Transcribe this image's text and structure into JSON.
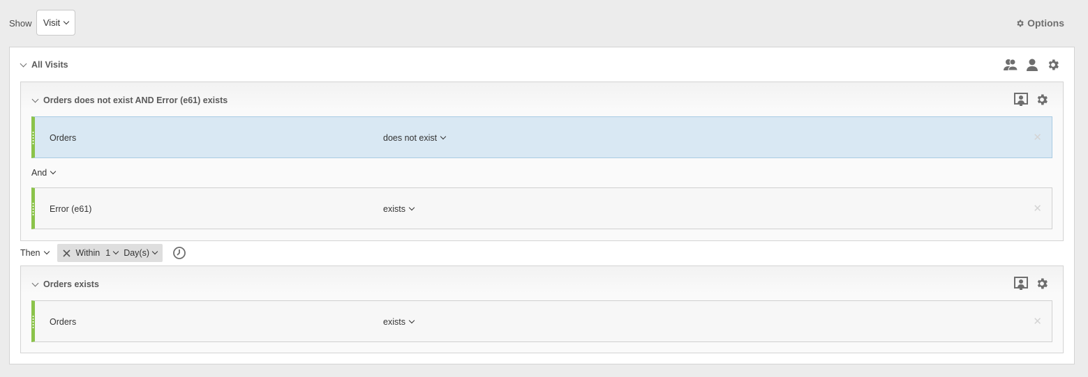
{
  "toolbar": {
    "show_label": "Show",
    "show_value": "Visit",
    "options_label": "Options"
  },
  "segment": {
    "title": "All Visits",
    "header_icons": [
      "people-icon",
      "person-icon",
      "gear-icon"
    ],
    "containers": [
      {
        "title": "Orders does not exist AND Error (e61) exists",
        "rules": [
          {
            "name": "Orders",
            "operator": "does not exist",
            "selected": true
          },
          {
            "name": "Error (e61)",
            "operator": "exists",
            "selected": false
          }
        ],
        "logic_operator": "And"
      },
      {
        "title": "Orders exists",
        "rules": [
          {
            "name": "Orders",
            "operator": "exists",
            "selected": false
          }
        ]
      }
    ],
    "sequence": {
      "then_label": "Then",
      "within_label": "Within",
      "within_count": "1",
      "within_unit": "Day(s)"
    }
  },
  "colors": {
    "rule_accent": "#8bc34a",
    "selected_rule_bg": "#d9e8f3",
    "page_bg": "#ececec"
  }
}
